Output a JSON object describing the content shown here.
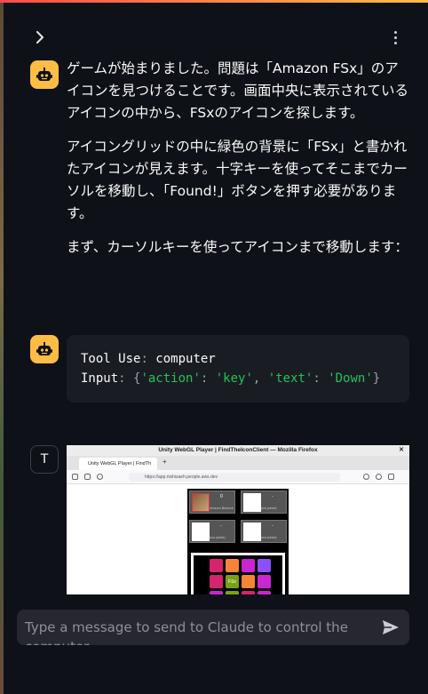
{
  "header": {
    "collapse_icon": "chevron-right-icon",
    "menu_icon": "kebab-menu-icon"
  },
  "messages": [
    {
      "role": "assistant",
      "avatar_icon": "robot-icon",
      "paragraphs": [
        "ゲームが始まりました。問題は「Amazon FSx」のアイコンを見つけることです。画面中央に表示されているアイコンの中から、FSxのアイコンを探します。",
        "アイコングリッドの中に緑色の背景に「FSx」と書かれたアイコンが見えます。十字キーを使ってそこまでカーソルを移動し、「Found!」ボタンを押す必要があります。",
        "まず、カーソルキーを使ってアイコンまで移動します："
      ]
    },
    {
      "role": "assistant",
      "avatar_icon": "robot-icon",
      "tool_use": {
        "label": "Tool Use",
        "tool": "computer",
        "input_label": "Input",
        "input": {
          "k1": "'action'",
          "v1": "'key'",
          "k2": "'text'",
          "v2": "'Down'"
        }
      }
    },
    {
      "role": "user",
      "avatar_letter": "T",
      "screenshot": {
        "window_title": "Unity WebGL Player | FindTheIconClient — Mozilla Firefox",
        "tab_title": "Unity WebGL Player | FindTh",
        "url": "https://app.nishizaeh.people.aws.dev",
        "slot1_num": "0",
        "slot1_caption": "Amazon Bedrock",
        "slot_placeholder_num": "-",
        "slot_placeholder_caption": "(not joined)",
        "fsx_label": "FSx"
      }
    }
  ],
  "chat_input": {
    "placeholder": "Type a message to send to Claude to control the computer...",
    "send_icon": "send-icon"
  },
  "colors": {
    "background": "#0e1117",
    "bot_avatar": "#ffbd45",
    "code_bg": "#1a1c24",
    "string_green": "#21c354",
    "input_bg": "#262730"
  }
}
